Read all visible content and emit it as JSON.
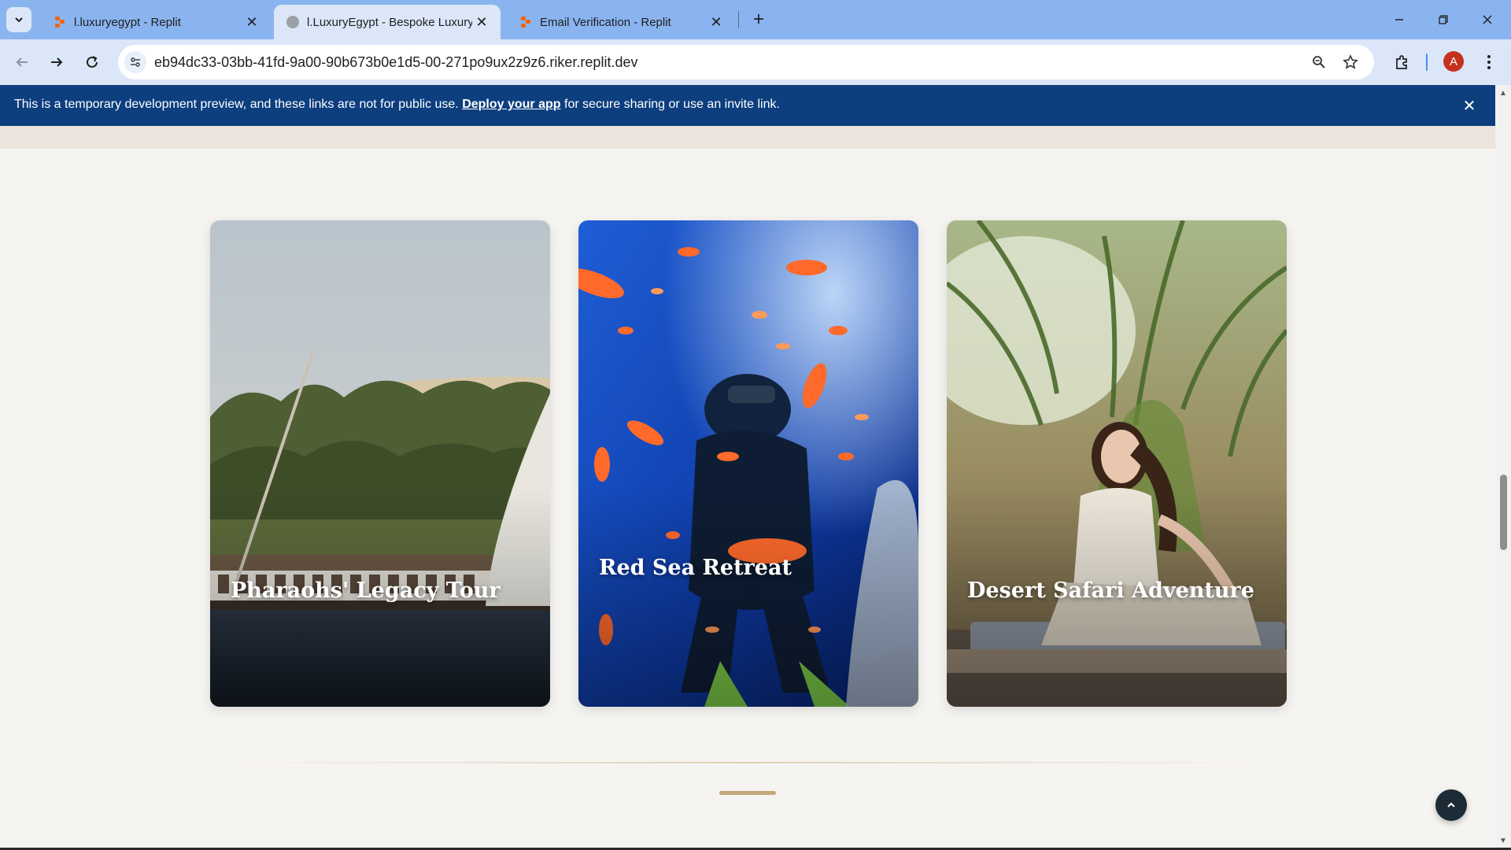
{
  "browser": {
    "tabs": [
      {
        "title": "l.luxuryegypt - Replit",
        "active": false,
        "favicon": "replit-icon"
      },
      {
        "title": "l.LuxuryEgypt - Bespoke Luxury",
        "active": true,
        "favicon": "globe-icon"
      },
      {
        "title": "Email Verification - Replit",
        "active": false,
        "favicon": "replit-icon"
      }
    ],
    "url": "eb94dc33-03bb-41fd-9a00-90b673b0e1d5-00-271po9ux2z9z6.riker.replit.dev",
    "profile_initial": "A",
    "accent_color": "#8ab4f0"
  },
  "banner": {
    "text_before": "This is a temporary development preview, and these links are not for public use. ",
    "link_text": "Deploy your app",
    "text_after": " for secure sharing or use an invite link.",
    "background_color": "#0d3f7f"
  },
  "cards": [
    {
      "title": "Pharaohs' Legacy Tour",
      "image": "nile-felucca-palm-trees"
    },
    {
      "title": "Red Sea Retreat",
      "image": "scuba-diver-coral-reef"
    },
    {
      "title": "Desert Safari Adventure",
      "image": "woman-palm-garden"
    }
  ],
  "icons": {
    "tab_search": "chevron-down-icon",
    "back": "arrow-left-icon",
    "forward": "arrow-right-icon",
    "reload": "reload-icon",
    "zoom": "zoom-icon",
    "bookmark": "star-icon",
    "extensions": "puzzle-icon",
    "menu": "kebab-menu-icon",
    "scroll_top": "chevron-up-icon"
  },
  "colors": {
    "page_background": "#f6f4f1",
    "gold_accent": "#c3a67a",
    "scroll_top_button": "#1c2b36"
  }
}
